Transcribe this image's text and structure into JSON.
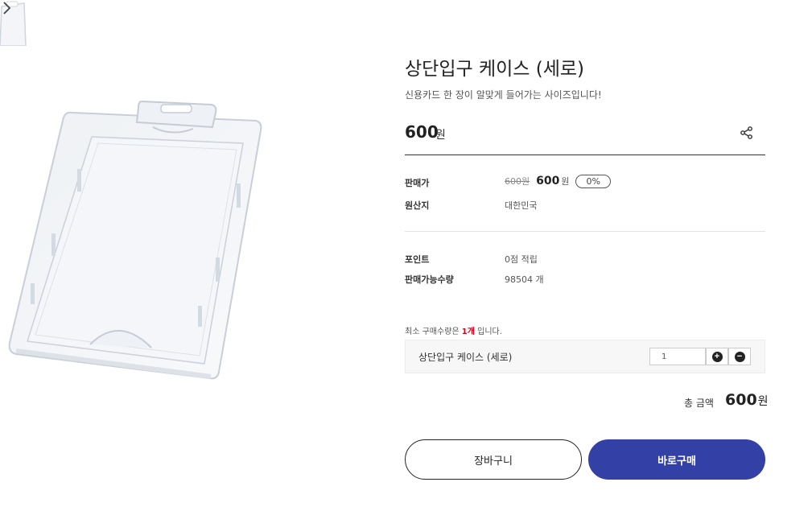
{
  "product": {
    "title": "상단입구 케이스 (세로)",
    "subtitle": "신용카드 한 장이 알맞게 들어가는 사이즈입니다!",
    "price": "600",
    "price_unit": "원"
  },
  "specs": {
    "sale_price_label": "판매가",
    "original_price": "600원",
    "sale_price": "600",
    "sale_price_unit": "원",
    "discount_badge": "0%",
    "origin_label": "원산지",
    "origin_value": "대한민국",
    "point_label": "포인트",
    "point_value": "0점 적립",
    "stock_label": "판매가능수량",
    "stock_value": "98504 개"
  },
  "order": {
    "min_qty_prefix": "최소 구매수량은 ",
    "min_qty_value": "1개",
    "min_qty_suffix": " 입니다.",
    "option_name": "상단입구 케이스 (세로)",
    "quantity": "1",
    "total_label": "총 금액",
    "total_price": "600",
    "total_unit": "원"
  },
  "buttons": {
    "cart": "장바구니",
    "buy": "바로구매"
  },
  "icons": {
    "share": "share-icon",
    "next": "chevron-right-icon",
    "plus": "plus-circle-icon",
    "minus": "minus-circle-icon"
  },
  "colors": {
    "buy_button": "#3340a5",
    "min_qty_highlight": "#d0021b"
  }
}
